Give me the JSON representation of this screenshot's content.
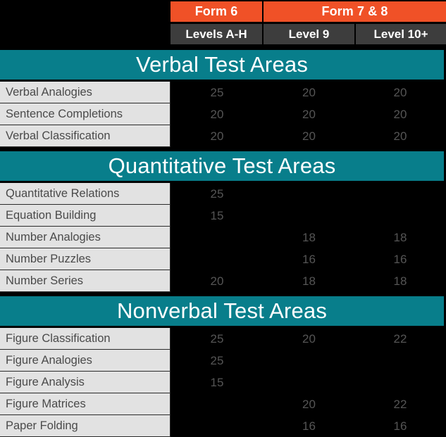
{
  "header": {
    "spacer_label": "",
    "forms": [
      {
        "label": "Form 6"
      },
      {
        "label": "Form 7 & 8"
      }
    ],
    "levels": [
      {
        "label": "Levels A-H"
      },
      {
        "label": "Level 9"
      },
      {
        "label": "Level 10+"
      }
    ]
  },
  "colors": {
    "orange": "#F05127",
    "dark_gray": "#3D3D3D",
    "teal": "#087E8B",
    "label_bg": "#E2E2E2",
    "background": "#000000",
    "number_text": "#555555"
  },
  "chart_data": {
    "type": "table",
    "title": "",
    "columns": [
      "",
      "Levels A-H",
      "Level 9",
      "Level 10+"
    ],
    "column_groups": [
      {
        "label": "Form 6",
        "spans": [
          "Levels A-H"
        ]
      },
      {
        "label": "Form 7 & 8",
        "spans": [
          "Level 9",
          "Level 10+"
        ]
      }
    ],
    "sections": [
      {
        "title": "Verbal Test Areas",
        "rows": [
          {
            "label": "Verbal Analogies",
            "values": [
              "25",
              "20",
              "20"
            ]
          },
          {
            "label": "Sentence Completions",
            "values": [
              "20",
              "20",
              "20"
            ]
          },
          {
            "label": "Verbal Classification",
            "values": [
              "20",
              "20",
              "20"
            ]
          }
        ]
      },
      {
        "title": "Quantitative Test Areas",
        "rows": [
          {
            "label": "Quantitative Relations",
            "values": [
              "25",
              "",
              ""
            ]
          },
          {
            "label": "Equation Building",
            "values": [
              "15",
              "",
              ""
            ]
          },
          {
            "label": "Number Analogies",
            "values": [
              "",
              "18",
              "18"
            ]
          },
          {
            "label": "Number Puzzles",
            "values": [
              "",
              "16",
              "16"
            ]
          },
          {
            "label": "Number Series",
            "values": [
              "20",
              "18",
              "18"
            ]
          }
        ]
      },
      {
        "title": "Nonverbal Test Areas",
        "rows": [
          {
            "label": "Figure Classification",
            "values": [
              "25",
              "20",
              "22"
            ]
          },
          {
            "label": "Figure Analogies",
            "values": [
              "25",
              "",
              ""
            ]
          },
          {
            "label": "Figure Analysis",
            "values": [
              "15",
              "",
              ""
            ]
          },
          {
            "label": "Figure Matrices",
            "values": [
              "",
              "20",
              "22"
            ]
          },
          {
            "label": "Paper Folding",
            "values": [
              "",
              "16",
              "16"
            ]
          }
        ]
      }
    ]
  }
}
